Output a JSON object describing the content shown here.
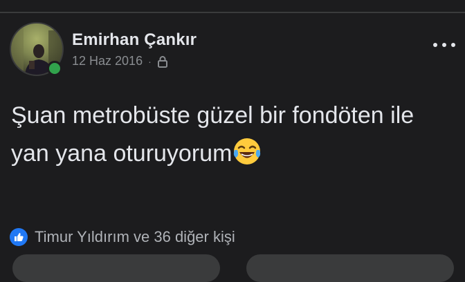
{
  "post": {
    "author_name": "Emirhan Çankır",
    "date": "12 Haz 2016",
    "separator": "·",
    "privacy_icon": "lock-icon",
    "text": "Şuan metrobüste güzel bir fondöten ile yan yana oturuyorum",
    "emoji": "face-with-tears-of-joy-icon",
    "online": true
  },
  "reactions": {
    "icon": "like-icon",
    "summary": "Timur Yıldırım ve 36 diğer kişi"
  },
  "menu": {
    "icon": "more-horizontal-icon"
  },
  "colors": {
    "background": "#1c1c1e",
    "text": "#e4e6eb",
    "secondary_text": "#8a8d91",
    "online": "#31a24c",
    "like_blue": "#2078f4"
  }
}
